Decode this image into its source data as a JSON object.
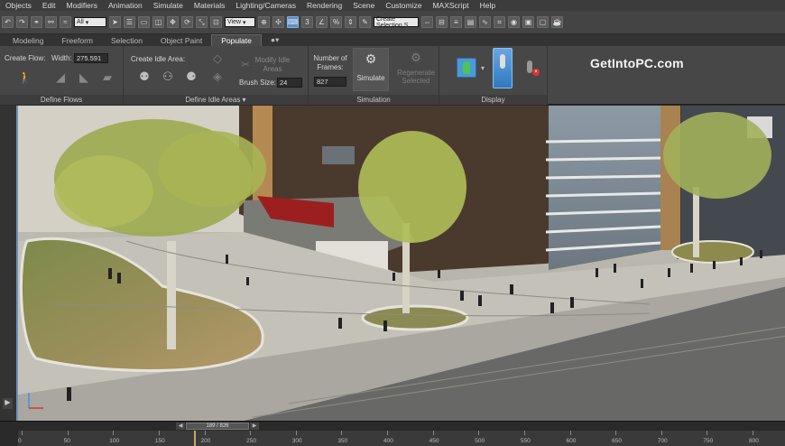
{
  "menubar": {
    "items": [
      "Objects",
      "Edit",
      "Modifiers",
      "Animation",
      "Simulate",
      "Materials",
      "Lighting/Cameras",
      "Rendering",
      "Scene",
      "Customize",
      "MAXScript",
      "Help"
    ]
  },
  "toolbar": {
    "filter_select": "All",
    "view_select": "View",
    "selection_set": "Create Selection S"
  },
  "ribbon_tabs": [
    "Modeling",
    "Freeform",
    "Selection",
    "Object Paint",
    "Populate"
  ],
  "active_tab": "Populate",
  "ribbon": {
    "define_flows": {
      "create_flow_label": "Create Flow:",
      "width_label": "Width:",
      "width_value": "275.591",
      "footer": "Define Flows"
    },
    "define_idle_areas": {
      "create_idle_label": "Create Idle Area:",
      "modify_idle_label": "Modify Idle Areas",
      "brush_size_label": "Brush Size:",
      "brush_size_value": "24",
      "footer": "Define Idle Areas ▾"
    },
    "simulation": {
      "frames_label": "Number of Frames:",
      "frames_value": "827",
      "simulate_label": "Simulate",
      "regenerate_label": "Regenerate Selected",
      "footer": "Simulation"
    },
    "display": {
      "footer": "Display"
    }
  },
  "watermark": "GetIntoPC.com",
  "timeline": {
    "frame_readout": "189 / 826",
    "ticks": [
      "0",
      "50",
      "100",
      "150",
      "200",
      "250",
      "300",
      "350",
      "400",
      "450",
      "500",
      "550",
      "600",
      "650",
      "700",
      "750",
      "800"
    ],
    "current_frame": 189,
    "total_frames": 826
  },
  "colors": {
    "accent": "#5b8ec9",
    "ribbon_bg": "#474747",
    "menubar_bg": "#3c3c3c"
  }
}
